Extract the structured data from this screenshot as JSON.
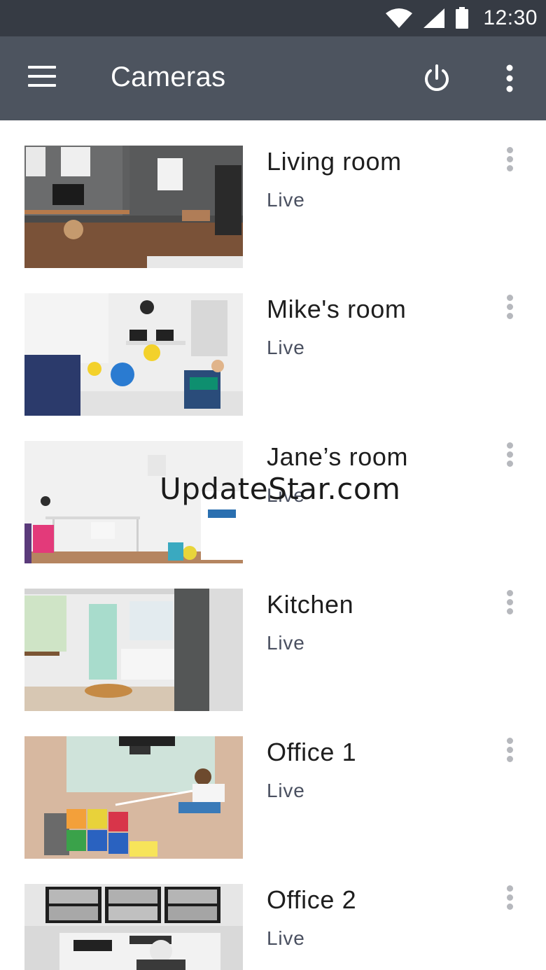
{
  "status_bar": {
    "time": "12:30"
  },
  "app_bar": {
    "title": "Cameras"
  },
  "cameras": [
    {
      "name": "Living room",
      "status": "Live"
    },
    {
      "name": "Mike's room",
      "status": "Live"
    },
    {
      "name": "Jane’s room",
      "status": "Live"
    },
    {
      "name": "Kitchen",
      "status": "Live"
    },
    {
      "name": "Office 1",
      "status": "Live"
    },
    {
      "name": "Office 2",
      "status": "Live"
    }
  ],
  "watermark": "UpdateStar.com",
  "icons": {
    "status_bar": [
      "wifi-icon",
      "cellular-signal-icon",
      "battery-icon"
    ],
    "app_bar": [
      "menu-icon",
      "power-icon",
      "more-vert-icon"
    ],
    "item": "more-vert-icon"
  },
  "colors": {
    "status_bar_bg": "#363b44",
    "app_bar_bg": "#4d545f",
    "title_text": "#ffffff",
    "name_text": "#1e1e1e",
    "status_text": "#4a5060",
    "overflow_dots": "#b6b8bd"
  }
}
